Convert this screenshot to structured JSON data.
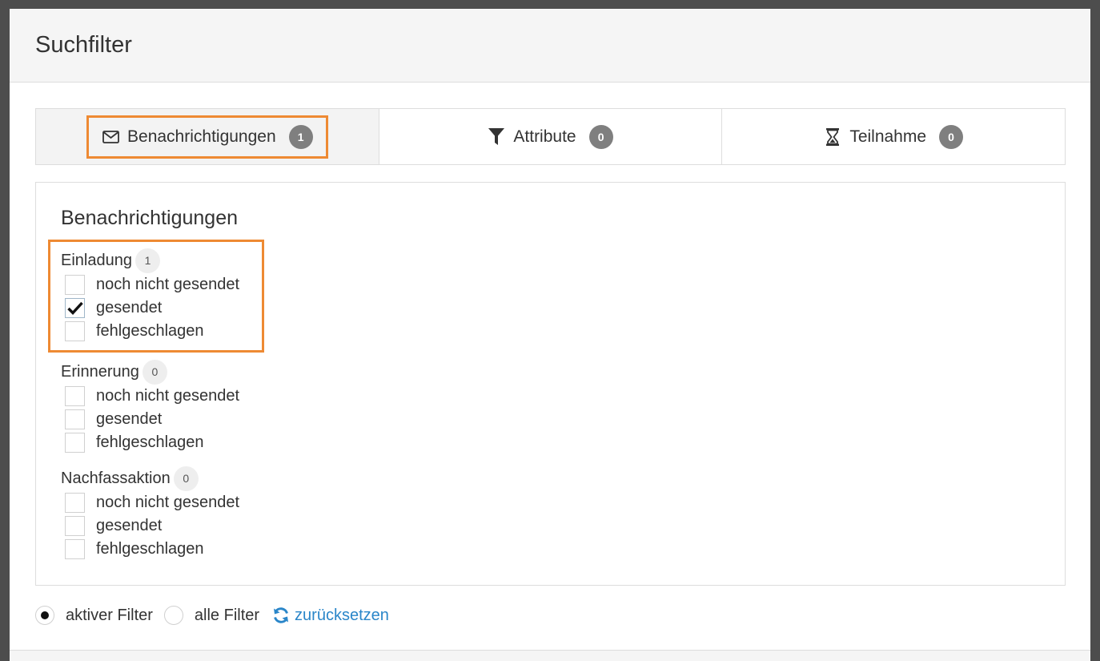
{
  "dialog": {
    "title": "Suchfilter"
  },
  "tabs": [
    {
      "label": "Benachrichtigungen",
      "count": "1",
      "icon": "envelope-icon",
      "active": true
    },
    {
      "label": "Attribute",
      "count": "0",
      "icon": "filter-icon",
      "active": false
    },
    {
      "label": "Teilnahme",
      "count": "0",
      "icon": "hourglass-icon",
      "active": false
    }
  ],
  "panel": {
    "title": "Benachrichtigungen",
    "groups": [
      {
        "label": "Einladung",
        "count": "1",
        "options": [
          {
            "label": "noch nicht gesendet",
            "checked": false
          },
          {
            "label": "gesendet",
            "checked": true
          },
          {
            "label": "fehlgeschlagen",
            "checked": false
          }
        ]
      },
      {
        "label": "Erinnerung",
        "count": "0",
        "options": [
          {
            "label": "noch nicht gesendet",
            "checked": false
          },
          {
            "label": "gesendet",
            "checked": false
          },
          {
            "label": "fehlgeschlagen",
            "checked": false
          }
        ]
      },
      {
        "label": "Nachfassaktion",
        "count": "0",
        "options": [
          {
            "label": "noch nicht gesendet",
            "checked": false
          },
          {
            "label": "gesendet",
            "checked": false
          },
          {
            "label": "fehlgeschlagen",
            "checked": false
          }
        ]
      }
    ]
  },
  "footer": {
    "active_filter_label": "aktiver Filter",
    "all_filters_label": "alle Filter",
    "reset_label": "zurücksetzen",
    "selected": "active"
  },
  "colors": {
    "highlight": "#ee8a33",
    "link": "#2a86c9",
    "badge_dark": "#7f7f7f",
    "badge_light": "#eeeeee"
  }
}
